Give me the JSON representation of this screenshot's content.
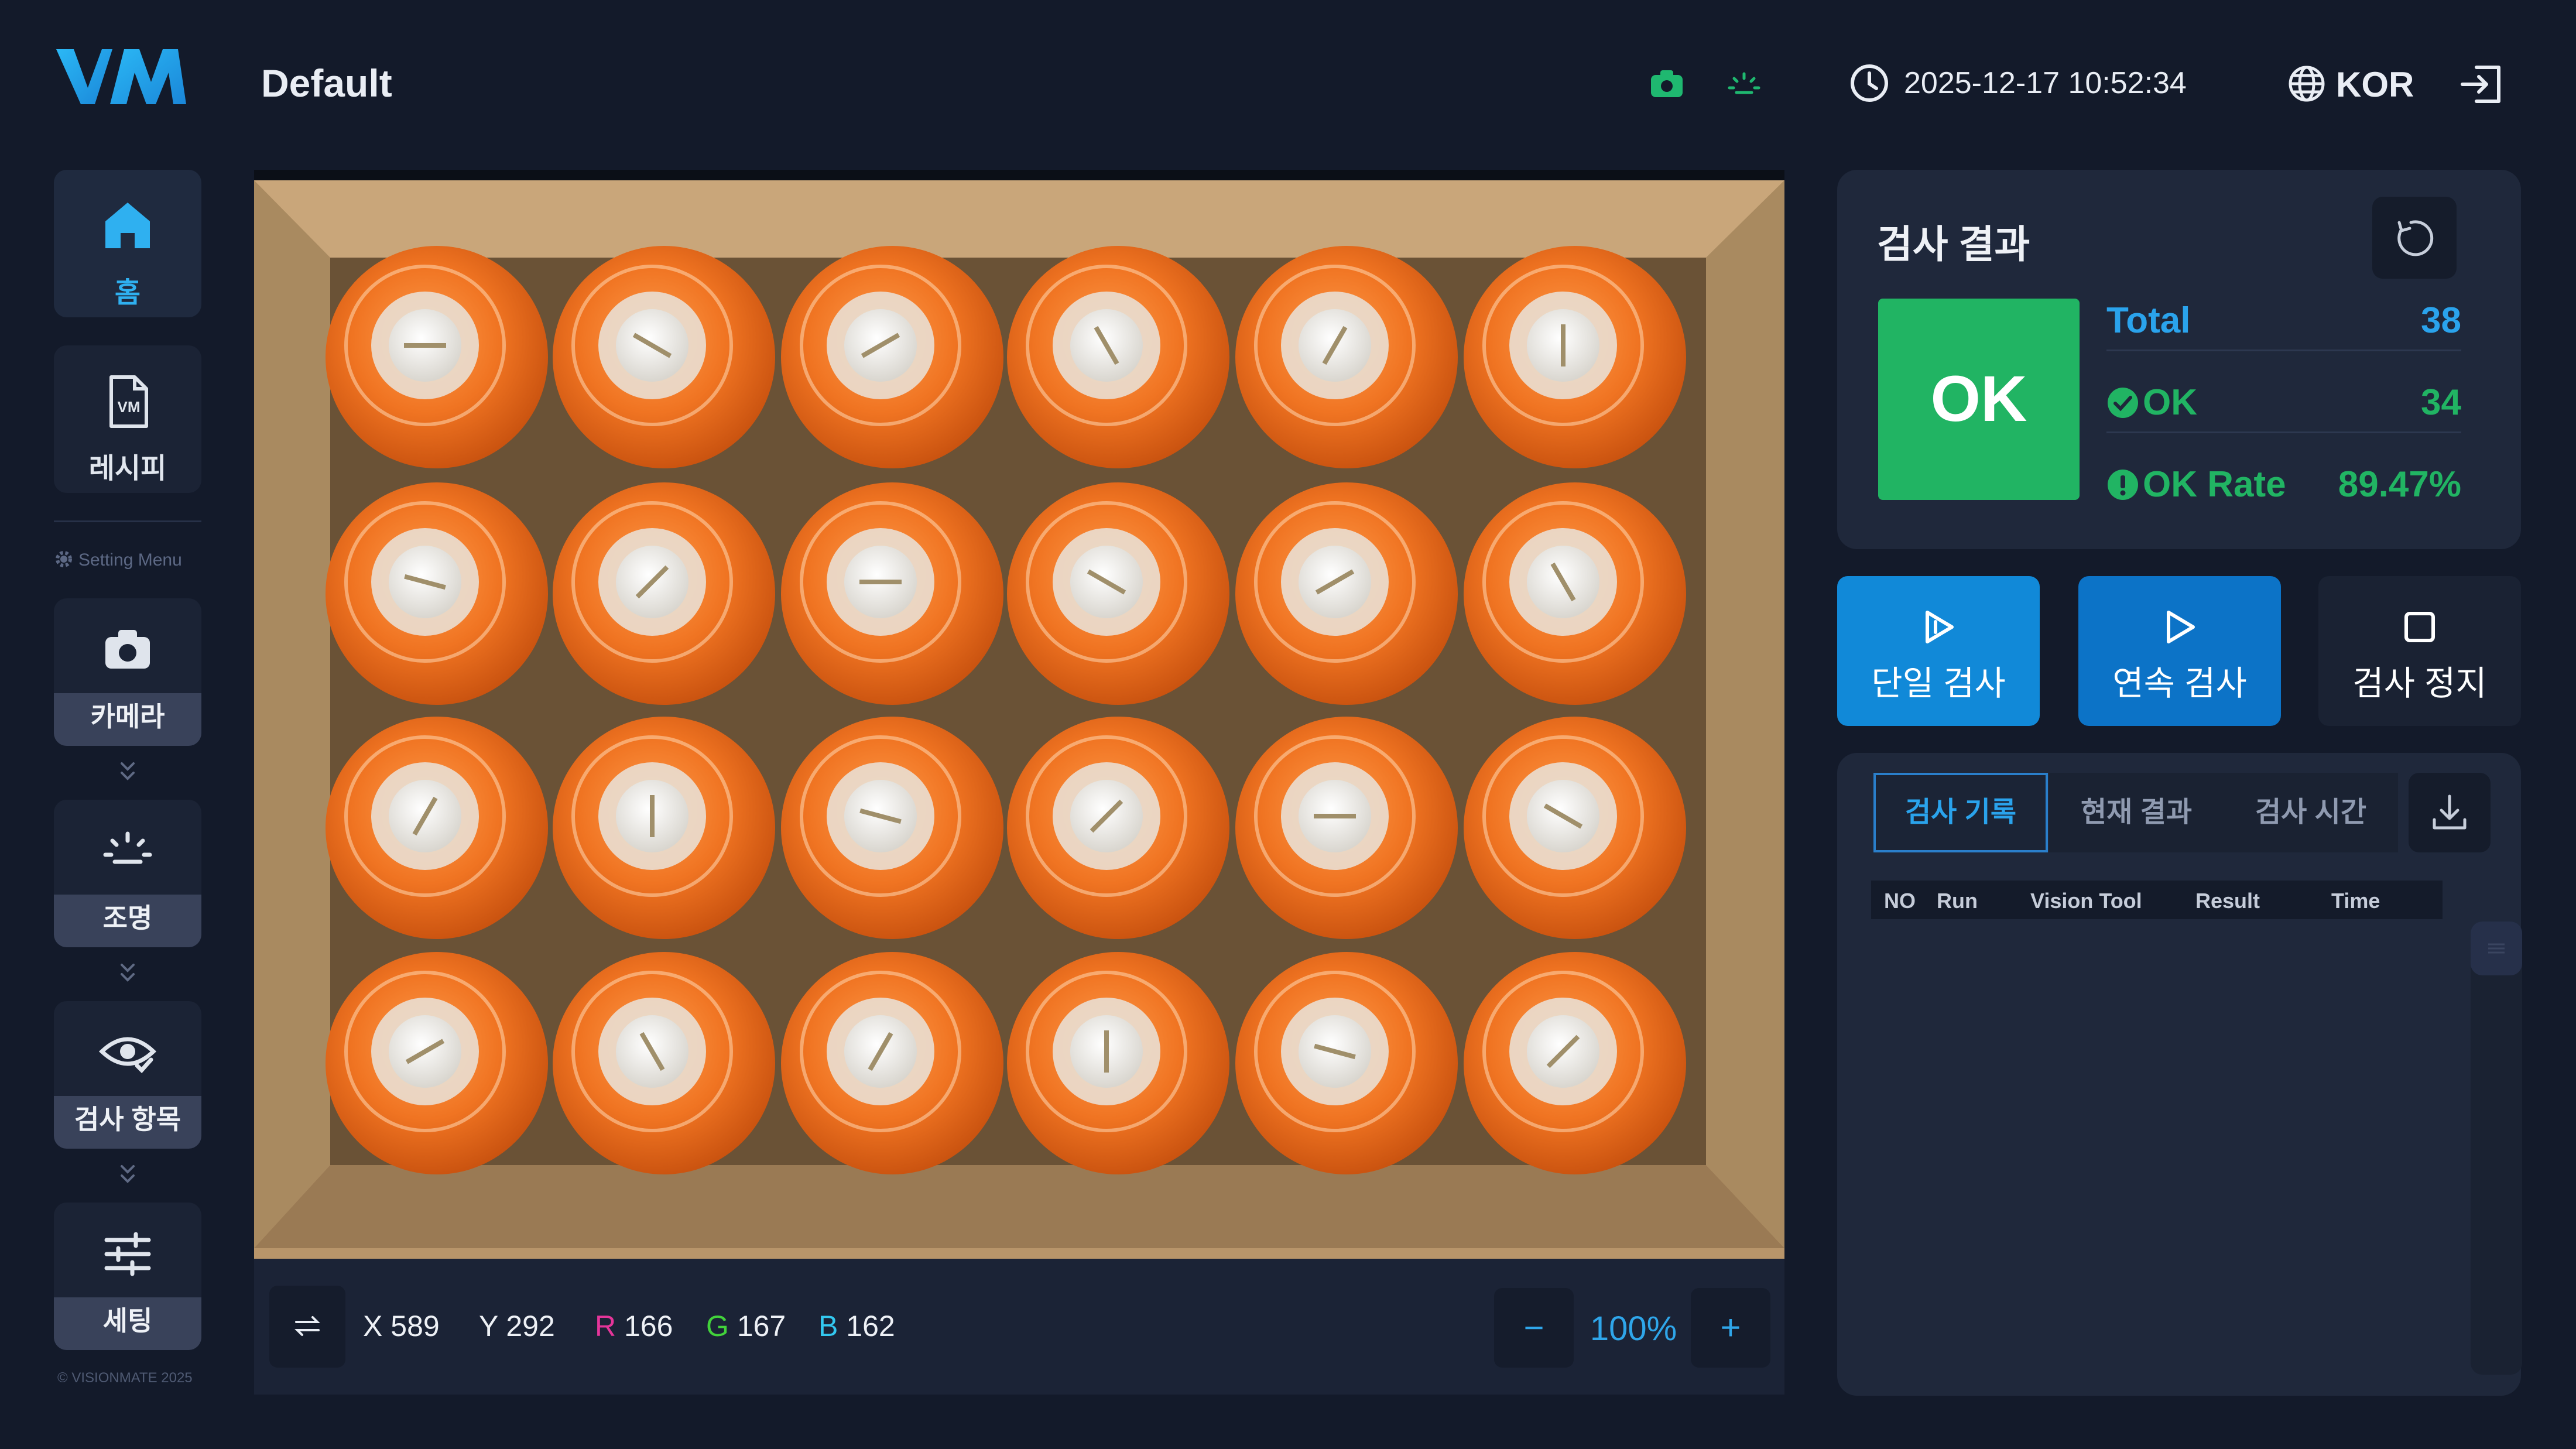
{
  "app": {
    "brand": "VM",
    "recipe_name": "Default"
  },
  "header": {
    "datetime": "2025-12-17 10:52:34",
    "language": "KOR",
    "status_colors": {
      "camera": "#1fb870",
      "light": "#1fb870"
    }
  },
  "sidebar": {
    "home_label": "홈",
    "recipe_label": "레시피",
    "setting_menu_label": "Setting Menu",
    "camera_label": "카메라",
    "lighting_label": "조명",
    "inspection_item_label": "검사 항목",
    "settings_label": "세팅",
    "copyright": "© VISIONMATE 2025"
  },
  "viewer": {
    "image_description": "4x6 grid of orange bottle caps in cardboard box",
    "x_label": "X",
    "x_value": "589",
    "y_label": "Y",
    "y_value": "292",
    "r_label": "R",
    "r_value": "166",
    "g_label": "G",
    "g_value": "167",
    "b_label": "B",
    "b_value": "162",
    "zoom": "100%",
    "zoom_out": "−",
    "zoom_in": "+"
  },
  "result": {
    "title": "검사 결과",
    "status": "OK",
    "total_label": "Total",
    "total_value": "38",
    "ok_label": "OK",
    "ok_value": "34",
    "rate_label": "OK Rate",
    "rate_value": "89.47%",
    "colors": {
      "ok": "#21b463",
      "accent": "#2aa3ec"
    }
  },
  "actions": {
    "single_label": "단일 검사",
    "continuous_label": "연속 검사",
    "stop_label": "검사 정지"
  },
  "log": {
    "tabs": [
      "검사 기록",
      "현재 결과",
      "검사 시간"
    ],
    "columns": [
      "NO",
      "Run",
      "Vision Tool",
      "Result",
      "Time"
    ],
    "rows": []
  }
}
